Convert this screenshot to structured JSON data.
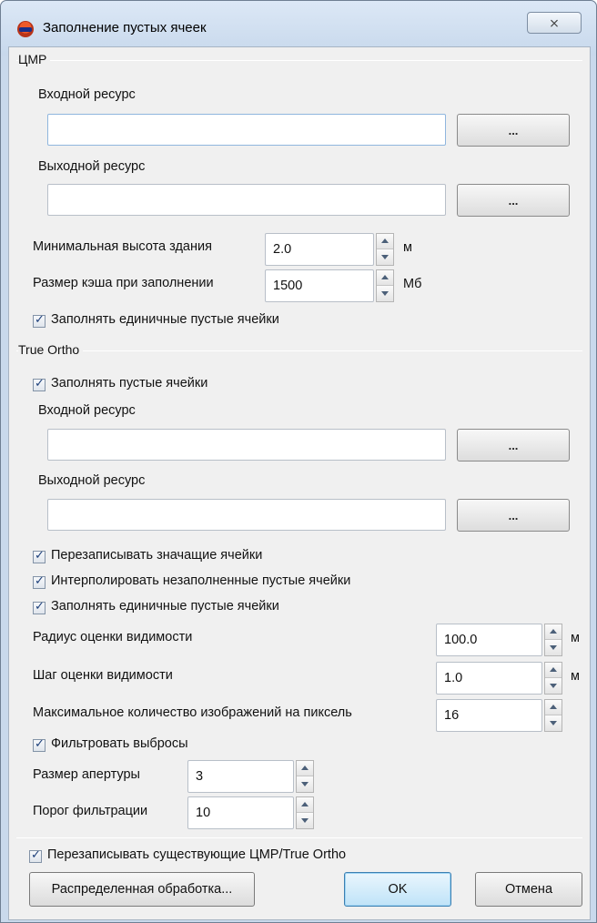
{
  "window": {
    "title": "Заполнение пустых ячеек",
    "close_glyph": "⨯"
  },
  "dem": {
    "group_title": "ЦМР",
    "input_label": "Входной ресурс",
    "input_value": "",
    "output_label": "Выходной ресурс",
    "output_value": "",
    "browse_label": "...",
    "min_height_label": "Минимальная высота здания",
    "min_height_value": "2.0",
    "min_height_unit": "м",
    "cache_label": "Размер кэша при заполнении",
    "cache_value": "1500",
    "cache_unit": "Мб",
    "fill_single_label": "Заполнять единичные пустые ячейки",
    "fill_single_checked": true
  },
  "true_ortho": {
    "group_title": "True Ortho",
    "fill_empty_label": "Заполнять пустые ячейки",
    "fill_empty_checked": true,
    "input_label": "Входной ресурс",
    "input_value": "",
    "output_label": "Выходной ресурс",
    "output_value": "",
    "browse_label": "...",
    "overwrite_label": "Перезаписывать значащие ячейки",
    "overwrite_checked": true,
    "interpolate_label": "Интерполировать незаполненные пустые ячейки",
    "interpolate_checked": true,
    "fill_single_label": "Заполнять единичные пустые ячейки",
    "fill_single_checked": true,
    "radius_label": "Радиус оценки видимости",
    "radius_value": "100.0",
    "radius_unit": "м",
    "step_label": "Шаг оценки видимости",
    "step_value": "1.0",
    "step_unit": "м",
    "max_images_label": "Максимальное количество изображений на пиксель",
    "max_images_value": "16",
    "filter_label": "Фильтровать выбросы",
    "filter_checked": true,
    "aperture_label": "Размер апертуры",
    "aperture_value": "3",
    "threshold_label": "Порог фильтрации",
    "threshold_value": "10"
  },
  "footer": {
    "overwrite_existing_label": "Перезаписывать существующие ЦМР/True Ortho",
    "overwrite_existing_checked": true,
    "distributed_label": "Распределенная обработка...",
    "ok_label": "OK",
    "cancel_label": "Отмена"
  }
}
